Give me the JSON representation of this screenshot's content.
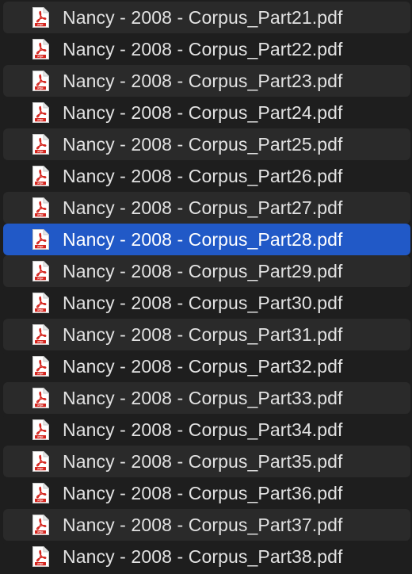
{
  "colors": {
    "background": "#1e1e1e",
    "row_alt": "#2a2a2a",
    "selection": "#2159c7",
    "text": "#e2e2e2",
    "pdf_red": "#d5251e"
  },
  "icon": "pdf-document-icon",
  "selected_index": 7,
  "files": [
    {
      "name": "Nancy - 2008 - Corpus_Part21.pdf"
    },
    {
      "name": "Nancy - 2008 - Corpus_Part22.pdf"
    },
    {
      "name": "Nancy - 2008 - Corpus_Part23.pdf"
    },
    {
      "name": "Nancy - 2008 - Corpus_Part24.pdf"
    },
    {
      "name": "Nancy - 2008 - Corpus_Part25.pdf"
    },
    {
      "name": "Nancy - 2008 - Corpus_Part26.pdf"
    },
    {
      "name": "Nancy - 2008 - Corpus_Part27.pdf"
    },
    {
      "name": "Nancy - 2008 - Corpus_Part28.pdf"
    },
    {
      "name": "Nancy - 2008 - Corpus_Part29.pdf"
    },
    {
      "name": "Nancy - 2008 - Corpus_Part30.pdf"
    },
    {
      "name": "Nancy - 2008 - Corpus_Part31.pdf"
    },
    {
      "name": "Nancy - 2008 - Corpus_Part32.pdf"
    },
    {
      "name": "Nancy - 2008 - Corpus_Part33.pdf"
    },
    {
      "name": "Nancy - 2008 - Corpus_Part34.pdf"
    },
    {
      "name": "Nancy - 2008 - Corpus_Part35.pdf"
    },
    {
      "name": "Nancy - 2008 - Corpus_Part36.pdf"
    },
    {
      "name": "Nancy - 2008 - Corpus_Part37.pdf"
    },
    {
      "name": "Nancy - 2008 - Corpus_Part38.pdf"
    }
  ]
}
